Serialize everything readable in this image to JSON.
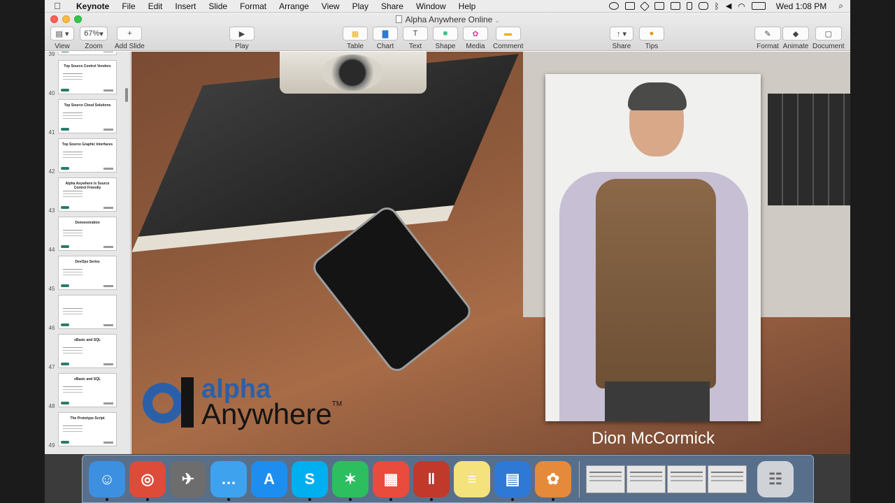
{
  "menubar": {
    "items": [
      "Keynote",
      "File",
      "Edit",
      "Insert",
      "Slide",
      "Format",
      "Arrange",
      "View",
      "Play",
      "Share",
      "Window",
      "Help"
    ],
    "clock": "Wed 1:08 PM",
    "status_icons": [
      "creative-cloud-icon",
      "screen-icon",
      "dropbox-icon",
      "upload-icon",
      "camera-icon",
      "bookmark-icon",
      "evernote-icon",
      "bluetooth-icon",
      "volume-icon",
      "wifi-icon",
      "battery-icon",
      "search-icon"
    ]
  },
  "window": {
    "title": "Alpha Anywhere Online",
    "toolbar": {
      "view": "View",
      "zoom_value": "67%",
      "zoom": "Zoom",
      "add_slide": "Add Slide",
      "play": "Play",
      "table": "Table",
      "chart": "Chart",
      "text": "Text",
      "shape": "Shape",
      "media": "Media",
      "comment": "Comment",
      "share": "Share",
      "tips": "Tips",
      "format": "Format",
      "animate": "Animate",
      "document": "Document"
    }
  },
  "slides": [
    {
      "num": "39",
      "title": ""
    },
    {
      "num": "40",
      "title": "Top Source Control Vendors"
    },
    {
      "num": "41",
      "title": "Top Source Cloud Solutions"
    },
    {
      "num": "42",
      "title": "Top Source Graphic Interfaces"
    },
    {
      "num": "43",
      "title": "Alpha Anywhere Is Source Control Friendly"
    },
    {
      "num": "44",
      "title": "Demonstration"
    },
    {
      "num": "45",
      "title": "DevOps Series"
    },
    {
      "num": "46",
      "title": ""
    },
    {
      "num": "47",
      "title": "xBasic and SQL"
    },
    {
      "num": "48",
      "title": "xBasic and SQL"
    },
    {
      "num": "49",
      "title": "The Prototype Script"
    }
  ],
  "current_slide": {
    "logo_alpha": "alpha",
    "logo_anywhere": "Anywhere",
    "logo_tm": "TM",
    "speaker_name": "Dion McCormick"
  },
  "dock": {
    "apps": [
      "Finder",
      "Chrome",
      "Launchpad",
      "Messages",
      "App Store",
      "Skype",
      "Evernote",
      "Microsoft Office",
      "Parallels",
      "Notes",
      "Keynote",
      "Alpha Anywhere"
    ],
    "colors": [
      "#3d8fe0",
      "#dd4b39",
      "#6d6d6d",
      "#3fa2ee",
      "#1d8ef0",
      "#00aff0",
      "#2dbe60",
      "#e94b3c",
      "#c0392b",
      "#f4e27d",
      "#2f79d6",
      "#e58a3a"
    ]
  }
}
